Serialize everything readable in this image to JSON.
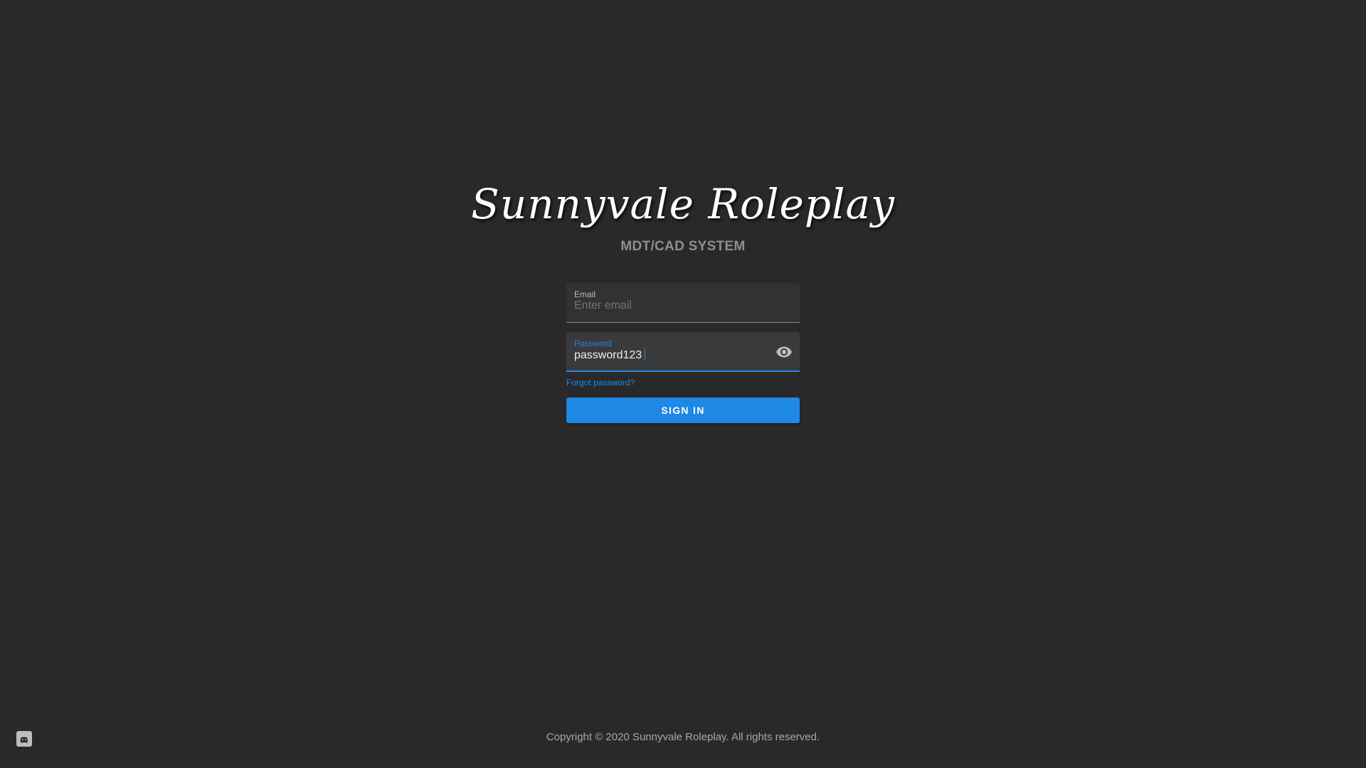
{
  "brand": {
    "title": "Sunnyvale Roleplay",
    "subtitle": "MDT/CAD SYSTEM"
  },
  "form": {
    "email": {
      "label": "Email",
      "placeholder": "Enter email",
      "value": ""
    },
    "password": {
      "label": "Password",
      "value": "password123",
      "toggle_icon": "eye-icon"
    },
    "forgot_link": "Forgot password?",
    "submit_label": "SIGN IN"
  },
  "footer": {
    "copyright": "Copyright © 2020 Sunnyvale Roleplay. All rights reserved.",
    "discord_icon": "discord-icon"
  },
  "colors": {
    "background": "#292929",
    "accent": "#1e88e5",
    "field_background": "#323232",
    "subtitle": "#8f8f8f"
  }
}
